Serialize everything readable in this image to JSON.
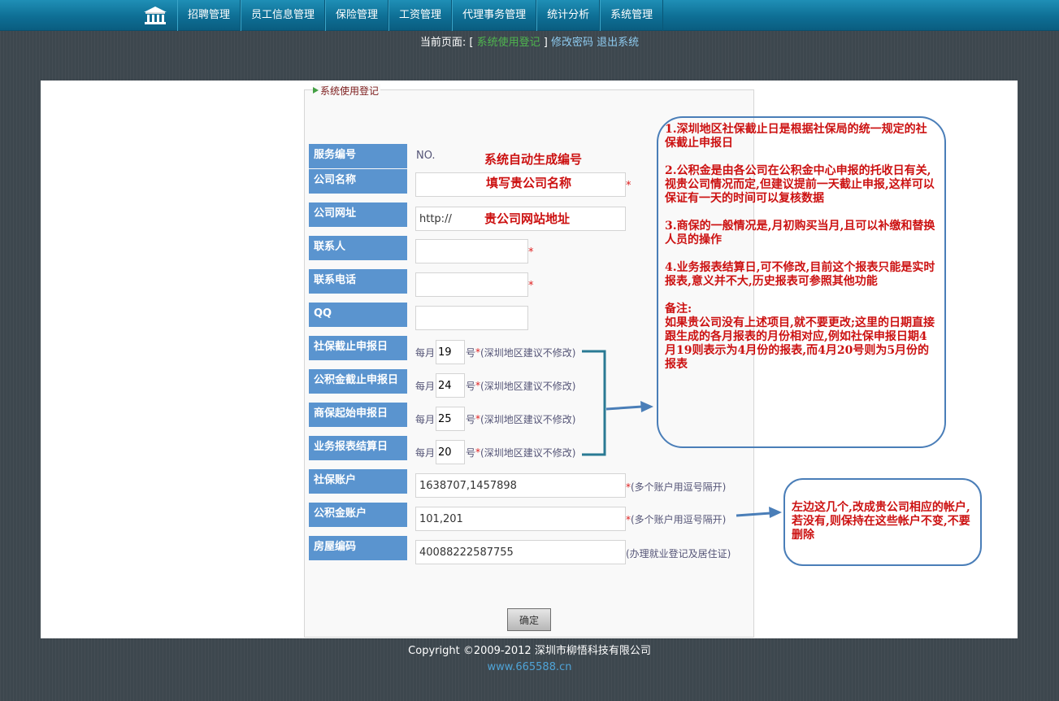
{
  "nav": {
    "items": [
      "招聘管理",
      "员工信息管理",
      "保险管理",
      "工资管理",
      "代理事务管理",
      "统计分析",
      "系统管理"
    ]
  },
  "breadcrumb": {
    "prefix": "当前页面: [",
    "current": "系统使用登记",
    "suffix": "]",
    "change_password": "修改密码",
    "logout": "退出系统"
  },
  "form": {
    "legend": "系统使用登记",
    "fields": {
      "service_no": {
        "label": "服务编号",
        "value": "NO."
      },
      "company_name": {
        "label": "公司名称",
        "value": ""
      },
      "company_site": {
        "label": "公司网址",
        "value": "http://"
      },
      "contact": {
        "label": "联系人",
        "value": ""
      },
      "phone": {
        "label": "联系电话",
        "value": ""
      },
      "qq": {
        "label": "QQ",
        "value": ""
      },
      "social_deadline": {
        "label": "社保截止申报日",
        "prefix": "每月",
        "value": "19",
        "suffix": "号",
        "note": "(深圳地区建议不修改)"
      },
      "fund_deadline": {
        "label": "公积金截止申报日",
        "prefix": "每月",
        "value": "24",
        "suffix": "号",
        "note": "(深圳地区建议不修改)"
      },
      "commercial_start": {
        "label": "商保起始申报日",
        "prefix": "每月",
        "value": "25",
        "suffix": "号",
        "note": "(深圳地区建议不修改)"
      },
      "report_settle": {
        "label": "业务报表结算日",
        "prefix": "每月",
        "value": "20",
        "suffix": "号",
        "note": "(深圳地区建议不修改)"
      },
      "social_account": {
        "label": "社保账户",
        "value": "1638707,1457898",
        "note": "(多个账户用逗号隔开)"
      },
      "fund_account": {
        "label": "公积金账户",
        "value": "101,201",
        "note": "(多个账户用逗号隔开)"
      },
      "house_code": {
        "label": "房屋编码",
        "value": "40088222587755",
        "note": "(办理就业登记及居住证)"
      }
    },
    "required_mark": "*",
    "submit_label": "确定"
  },
  "annotations": {
    "auto_no": "系统自动生成编号",
    "fill_name": "填写贵公司名称",
    "site_addr": "贵公司网站地址",
    "bubble_right": [
      "1.深圳地区社保截止日是根据社保局的统一规定的社保截止申报日",
      "2.公积金是由各公司在公积金中心申报的托收日有关,视贵公司情况而定,但建议提前一天截止申报,这样可以保证有一天的时间可以复核数据",
      "3.商保的一般情况是,月初购买当月,且可以补缴和替换人员的操作",
      "4.业务报表结算日,可不修改,目前这个报表只能是实时报表,意义并不大,历史报表可参照其他功能",
      "备注:",
      "如果贵公司没有上述项目,就不要更改;这里的日期直接跟生成的各月报表的月份相对应,例如社保申报日期4月19则表示为4月份的报表,而4月20号则为5月份的报表"
    ],
    "bubble_bottom": "左边这几个,改成贵公司相应的帐户,若没有,则保持在这些帐户不变,不要删除"
  },
  "footer": {
    "copyright": "Copyright ©2009-2012 深圳市柳悟科技有限公司",
    "site": "www.665588.cn"
  },
  "colors": {
    "nav_bg": "#0e6f95",
    "label_bg": "#5a94cf",
    "annotation_red": "#cc1111",
    "bubble_border": "#4a7eb8"
  }
}
